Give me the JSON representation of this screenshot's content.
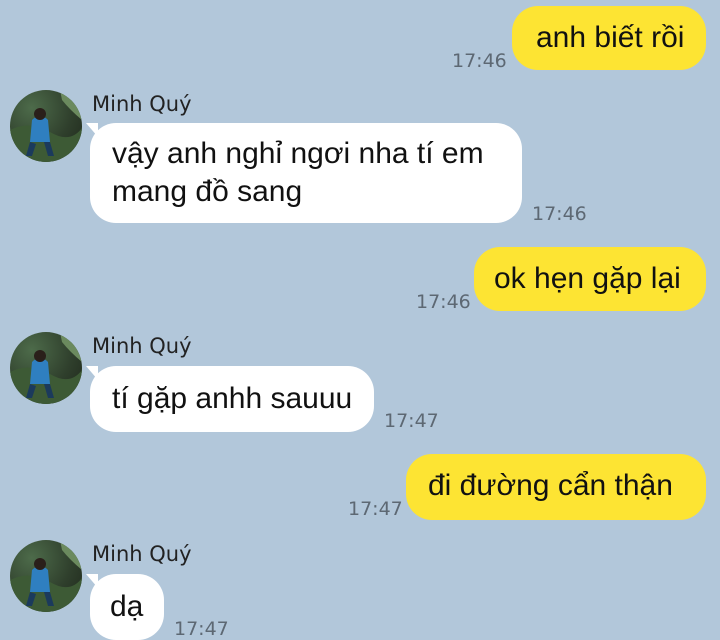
{
  "messages": [
    {
      "direction": "out",
      "lines": [
        "anh biết rồi"
      ],
      "time": "17:46"
    },
    {
      "direction": "in",
      "sender": "Minh Quý",
      "lines": [
        "vậy anh nghỉ ngơi nha tí em",
        "mang đồ sang"
      ],
      "time": "17:46"
    },
    {
      "direction": "out",
      "lines": [
        "ok hẹn gặp lại"
      ],
      "time": "17:46"
    },
    {
      "direction": "in",
      "sender": "Minh Quý",
      "lines": [
        "tí gặp anhh sauuu"
      ],
      "time": "17:47"
    },
    {
      "direction": "out",
      "lines": [
        "đi đường cẩn thận"
      ],
      "time": "17:47"
    },
    {
      "direction": "in",
      "sender": "Minh Quý",
      "lines": [
        "dạ"
      ],
      "time": "17:47"
    }
  ],
  "colors": {
    "background": "#b2c7da",
    "outgoing_bubble": "#fde433",
    "incoming_bubble": "#ffffff",
    "timestamp": "#5d6873"
  },
  "icons": {
    "avatar": "contact-avatar-photo"
  }
}
